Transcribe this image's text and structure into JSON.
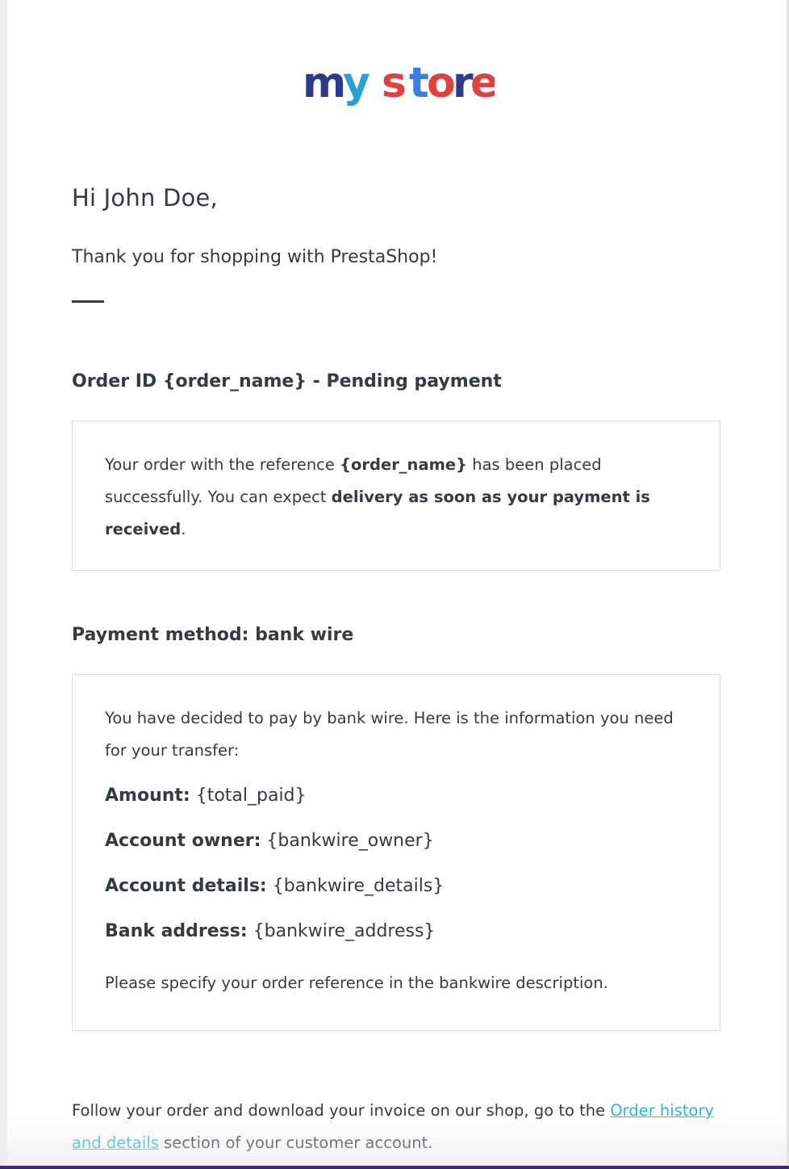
{
  "logo": {
    "word1": "my",
    "word2": "store",
    "colors": {
      "m": "#2b3a8f",
      "y": "#2a9fd6",
      "s": "#e0413f",
      "t": "#3a7ee0",
      "o": "#e0413f",
      "r": "#2b3a8f",
      "e": "#e0413f"
    }
  },
  "greeting": "Hi John Doe,",
  "thanks": "Thank you for shopping with PrestaShop!",
  "order": {
    "title": "Order ID {order_name} - Pending payment",
    "text_1": "Your order with the reference ",
    "reference": "{order_name}",
    "text_2": " has been placed successfully. You can expect ",
    "delivery_bold": "delivery as soon as your payment is received",
    "text_3": "."
  },
  "payment": {
    "title": "Payment method: bank wire",
    "intro": "You have decided to pay by bank wire. Here is the information you need for your transfer:",
    "lines": [
      {
        "label": "Amount:",
        "value": " {total_paid}"
      },
      {
        "label": "Account owner:",
        "value": " {bankwire_owner}"
      },
      {
        "label": "Account details:",
        "value": " {bankwire_details}"
      },
      {
        "label": "Bank address:",
        "value": " {bankwire_address}"
      }
    ],
    "note": "Please specify your order reference in the bankwire description."
  },
  "follow": {
    "text_1": "Follow your order and download your invoice on our shop, go to the ",
    "link": "Order history and details",
    "text_2": " section of your customer account."
  },
  "colors": {
    "text": "#363a41",
    "link": "#25b9d7",
    "border": "#dcdde0"
  }
}
